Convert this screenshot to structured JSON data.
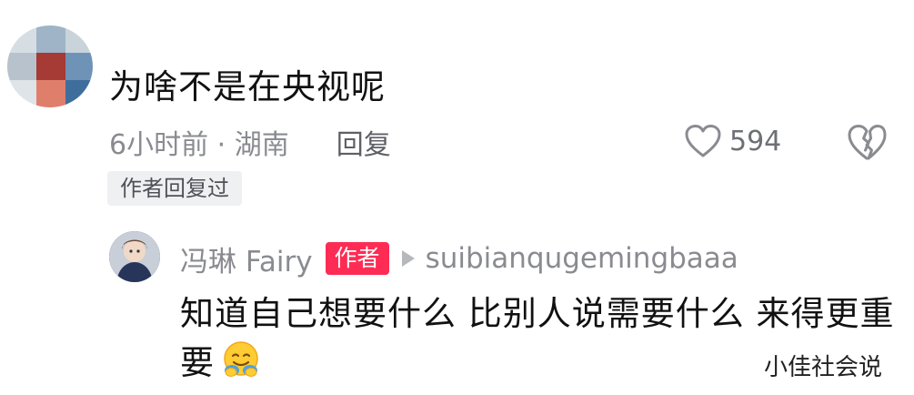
{
  "comment": {
    "text": "为啥不是在央视呢",
    "time_location": "6小时前 · 湖南",
    "reply_label": "回复",
    "like_count": "594",
    "author_replied_tag": "作者回复过"
  },
  "reply": {
    "author_name": "冯琳 Fairy",
    "author_badge": "作者",
    "reply_to": "suibianqugemingbaaa",
    "text": "知道自己想要什么 比别人说需要什么 来得更重要",
    "emoji": "hugging-face-emoji"
  },
  "watermark": "小佳社会说",
  "colors": {
    "accent": "#fe2c55",
    "meta_gray": "#8a8b91",
    "text": "#111111"
  },
  "icons": [
    "heart-outline-icon",
    "broken-heart-icon",
    "play-arrow-icon"
  ]
}
